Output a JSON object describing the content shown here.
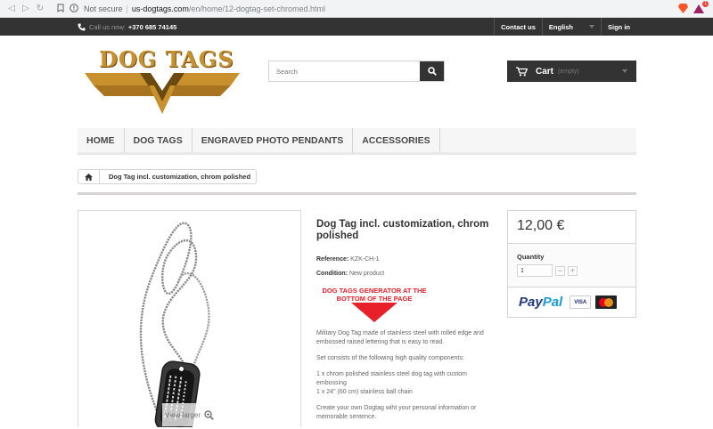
{
  "browser": {
    "security_label": "Not secure",
    "url_host": "us-dogtags.com",
    "url_path": "/en/home/12-dogtag-set-chromed.html",
    "ext_badge": "1"
  },
  "topbar": {
    "phone_label": "Call us now:",
    "phone_number": "+370 685 74145",
    "contact": "Contact us",
    "language": "English",
    "signin": "Sign in"
  },
  "header": {
    "logo_text": "DOG TAGS",
    "search_placeholder": "Search",
    "cart_label": "Cart",
    "cart_status": "(empty)"
  },
  "menu": {
    "items": [
      "Home",
      "Dog Tags",
      "Engraved Photo Pendants",
      "Accessories"
    ]
  },
  "breadcrumb": {
    "current": "Dog Tag incl. customization, chrom polished"
  },
  "product": {
    "view_larger": "View larger",
    "title": "Dog Tag incl. customization, chrom polished",
    "reference_label": "Reference:",
    "reference_value": "KZK-CH-1",
    "condition_label": "Condition:",
    "condition_value": "New product",
    "promo_text": "DOG TAGS GENERATOR AT THE BOTTOM OF THE PAGE",
    "desc_1": "Military Dog Tag made of stainless steel with rolled edge and embossed raised lettering that is easy to read.",
    "desc_2": "Set consists of the following high quality components:",
    "desc_3a": "1 x chrom polished stainless steel dog tag with custom embossing",
    "desc_3b": "1 x 24\" (60 cm) stainless ball chain",
    "desc_4": "Create your own Dogtag wiht your personal information or memorable sentence."
  },
  "pricebox": {
    "price": "12,00 €",
    "quantity_label": "Quantity",
    "quantity_value": "1",
    "minus": "−",
    "plus": "+",
    "paypal_pay": "Pay",
    "paypal_pal": "Pal",
    "visa": "VISA"
  }
}
